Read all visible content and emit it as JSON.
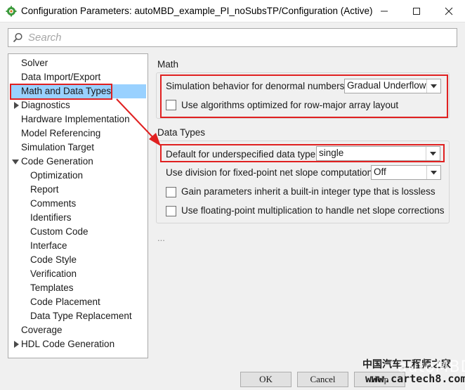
{
  "window": {
    "title": "Configuration Parameters: autoMBD_example_PI_noSubsTP/Configuration (Active)",
    "app_icon": "simulink-gear-icon",
    "controls": [
      "minimize-icon",
      "maximize-icon",
      "close-icon"
    ]
  },
  "search": {
    "placeholder": "Search",
    "icon": "search-icon"
  },
  "tree": {
    "items": [
      {
        "label": "Solver"
      },
      {
        "label": "Data Import/Export"
      },
      {
        "label": "Math and Data Types",
        "selected": true
      },
      {
        "label": "Diagnostics",
        "expander": "collapsed"
      },
      {
        "label": "Hardware Implementation"
      },
      {
        "label": "Model Referencing"
      },
      {
        "label": "Simulation Target"
      },
      {
        "label": "Code Generation",
        "expander": "expanded"
      },
      {
        "label": "Optimization"
      },
      {
        "label": "Report"
      },
      {
        "label": "Comments"
      },
      {
        "label": "Identifiers"
      },
      {
        "label": "Custom Code"
      },
      {
        "label": "Interface"
      },
      {
        "label": "Code Style"
      },
      {
        "label": "Verification"
      },
      {
        "label": "Templates"
      },
      {
        "label": "Code Placement"
      },
      {
        "label": "Data Type Replacement"
      },
      {
        "label": "Coverage"
      },
      {
        "label": "HDL Code Generation",
        "expander": "collapsed"
      }
    ]
  },
  "math": {
    "title": "Math",
    "denormal_label": "Simulation behavior for denormal numbers:",
    "denormal_value": "Gradual Underflow",
    "rowmajor_label": "Use algorithms optimized for row-major array layout",
    "rowmajor_checked": false
  },
  "data_types": {
    "title": "Data Types",
    "default_label": "Default for underspecified data type:",
    "default_value": "single",
    "division_label": "Use division for fixed-point net slope computation:",
    "division_value": "Off",
    "gain_label": "Gain parameters inherit a built-in integer type that is lossless",
    "gain_checked": false,
    "float_label": "Use floating-point multiplication to handle net slope corrections",
    "float_checked": false
  },
  "more": "...",
  "buttons": {
    "ok": "OK",
    "cancel": "Cancel",
    "help": "Help"
  },
  "watermark": {
    "line1": "中国汽车工程师之家",
    "line2": "www.cartech8.com",
    "overlay": "autoMBD"
  },
  "colors": {
    "selection": "#99d1ff",
    "highlight": "#e02020"
  }
}
